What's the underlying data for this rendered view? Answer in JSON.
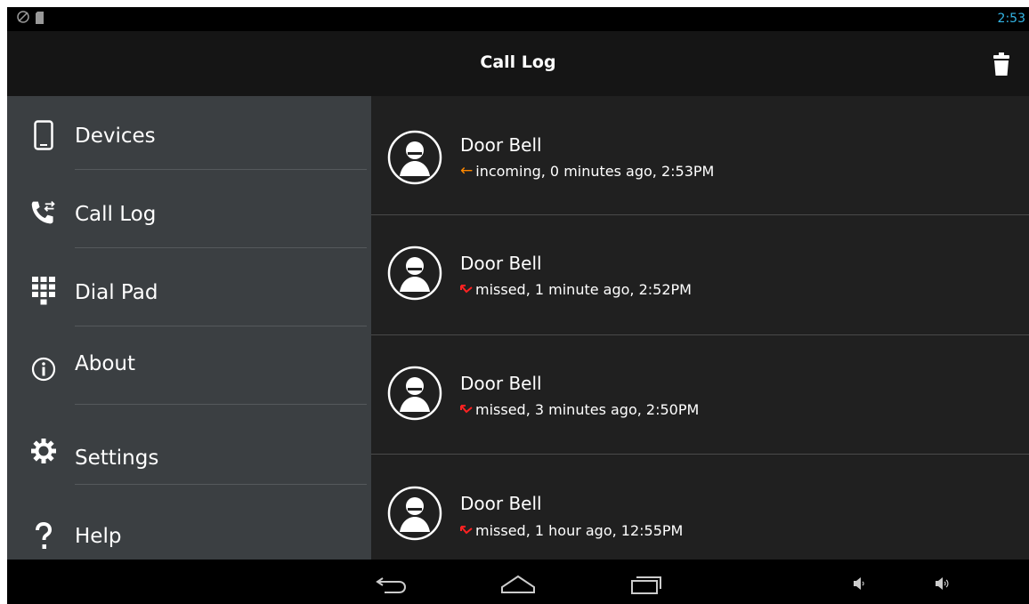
{
  "status_bar": {
    "time": "2:53",
    "icons": [
      "rotation-lock-icon",
      "sd-card-icon"
    ]
  },
  "action_bar": {
    "title": "Call Log",
    "action_icon": "trash-icon"
  },
  "drawer": {
    "items": [
      {
        "label": "Devices",
        "icon": "phone-device-icon"
      },
      {
        "label": "Call Log",
        "icon": "call-log-icon"
      },
      {
        "label": "Dial Pad",
        "icon": "dial-pad-icon"
      },
      {
        "label": "About",
        "icon": "info-icon"
      },
      {
        "label": "Settings",
        "icon": "gear-icon"
      },
      {
        "label": "Help",
        "icon": "question-icon"
      }
    ]
  },
  "call_log": {
    "entries": [
      {
        "name": "Door Bell",
        "detail": "incoming, 0 minutes ago, 2:53PM",
        "type": "incoming",
        "arrow_color": "#ff8800"
      },
      {
        "name": "Door Bell",
        "detail": "missed, 1 minute ago, 2:52PM",
        "type": "missed",
        "arrow_color": "#ff2222"
      },
      {
        "name": "Door Bell",
        "detail": "missed, 3 minutes ago, 2:50PM",
        "type": "missed",
        "arrow_color": "#ff2222"
      },
      {
        "name": "Door Bell",
        "detail": "missed, 1 hour ago, 12:55PM",
        "type": "missed",
        "arrow_color": "#ff2222"
      }
    ]
  },
  "nav_bar": {
    "buttons": [
      "back-icon",
      "home-icon",
      "recent-apps-icon",
      "volume-down-icon",
      "volume-up-icon"
    ]
  },
  "colors": {
    "accent": "#33b5e5",
    "drawer_bg": "#3b3f42",
    "list_bg": "#202020"
  }
}
